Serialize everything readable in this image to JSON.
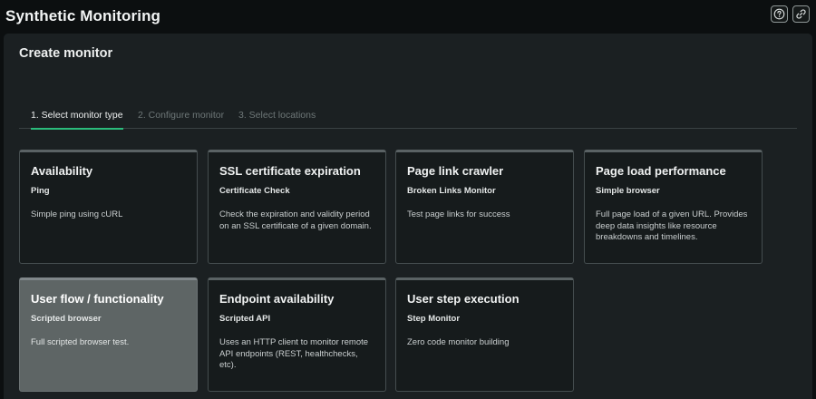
{
  "app": {
    "title": "Synthetic Monitoring"
  },
  "panel": {
    "title": "Create monitor"
  },
  "steps": [
    {
      "label": "1. Select monitor type",
      "active": true
    },
    {
      "label": "2. Configure monitor",
      "active": false
    },
    {
      "label": "3. Select locations",
      "active": false
    }
  ],
  "cards": [
    {
      "title": "Availability",
      "subtitle": "Ping",
      "description": "Simple ping using cURL"
    },
    {
      "title": "SSL certificate expiration",
      "subtitle": "Certificate Check",
      "description": "Check the expiration and validity period on an SSL certificate of a given domain."
    },
    {
      "title": "Page link crawler",
      "subtitle": "Broken Links Monitor",
      "description": "Test page links for success"
    },
    {
      "title": "Page load performance",
      "subtitle": "Simple browser",
      "description": "Full page load of a given URL. Provides deep data insights like resource breakdowns and timelines."
    },
    {
      "title": "User flow / functionality",
      "subtitle": "Scripted browser",
      "description": "Full scripted browser test.",
      "hovered": true
    },
    {
      "title": "Endpoint availability",
      "subtitle": "Scripted API",
      "description": "Uses an HTTP client to monitor remote API endpoints (REST, healthchecks, etc)."
    },
    {
      "title": "User step execution",
      "subtitle": "Step Monitor",
      "description": "Zero code monitor building"
    }
  ],
  "icons": {
    "help": "help-circle-icon",
    "link": "link-icon"
  },
  "colors": {
    "active_step_underline": "#2bbc7c",
    "panel_bg": "#1b2022",
    "card_bg": "#161b1c",
    "card_hover_bg": "#5e6565"
  }
}
